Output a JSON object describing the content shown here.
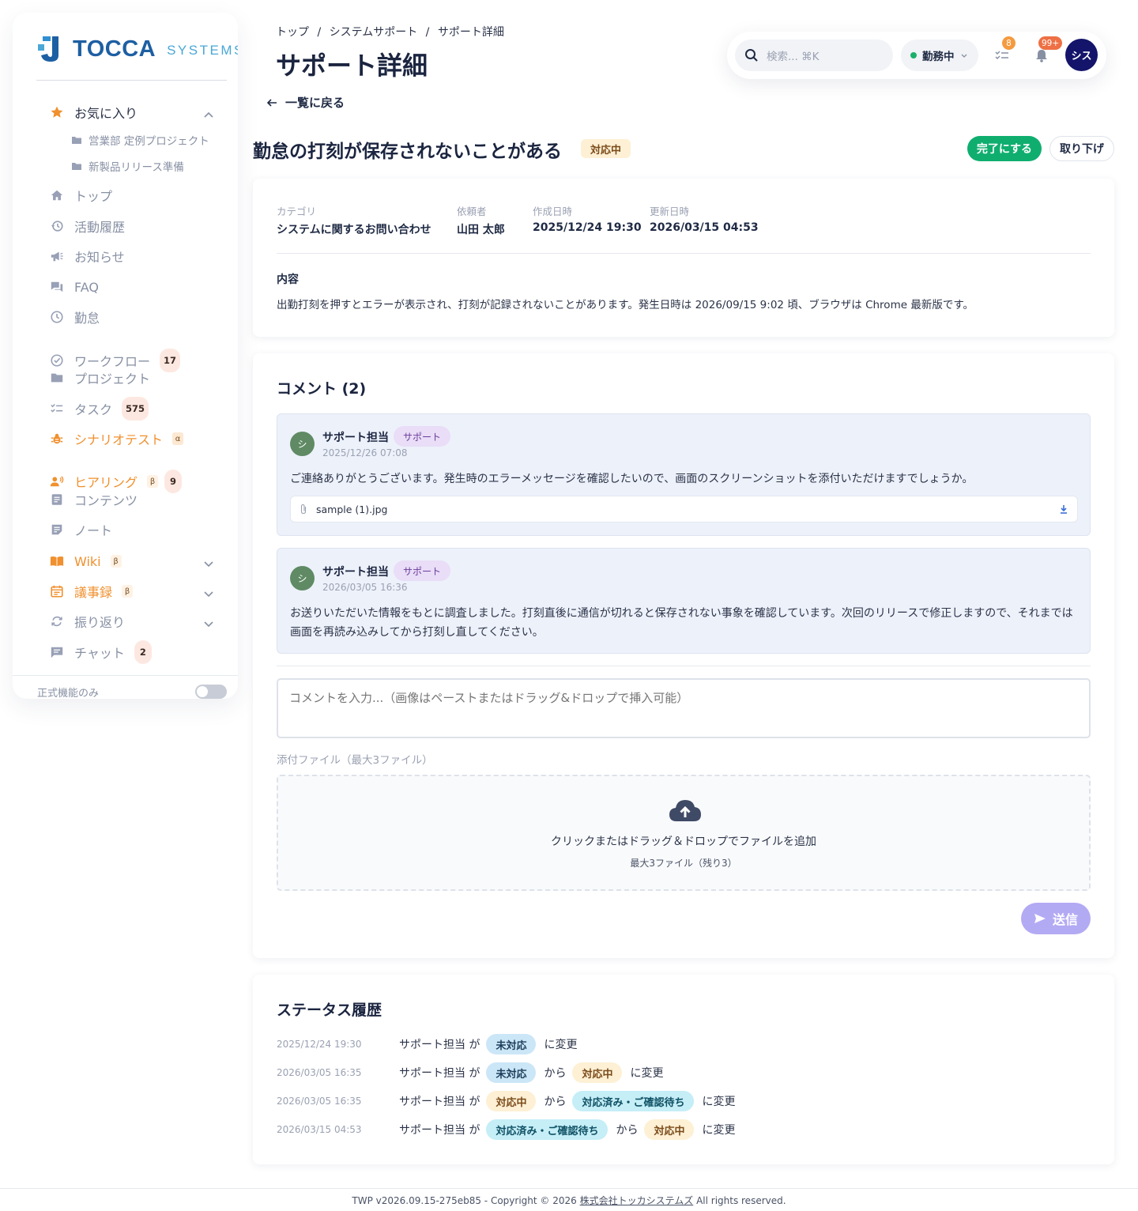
{
  "brand": {
    "name_main": "TOCCA",
    "name_sub": "SYSTEMS"
  },
  "colors": {
    "accent": "#1d5fa3",
    "orange": "#f0902e",
    "green": "#0fae6f",
    "purple": "#b3aaf4",
    "navy": "#13146a"
  },
  "sidebar": {
    "favorites_label": "お気に入り",
    "favorites": [
      "営業部 定例プロジェクト",
      "新製品リリース準備"
    ],
    "items": [
      {
        "label": "トップ",
        "icon": "home-icon"
      },
      {
        "label": "活動履歴",
        "icon": "history-icon"
      },
      {
        "label": "お知らせ",
        "icon": "megaphone-icon"
      },
      {
        "label": "FAQ",
        "icon": "faq-icon"
      },
      {
        "label": "勤怠",
        "icon": "clock-icon"
      },
      {
        "label": "ワークフロー",
        "icon": "check-circle-icon",
        "count": "17"
      },
      {
        "label": "プロジェクト",
        "icon": "folder-icon"
      },
      {
        "label": "タスク",
        "icon": "tasks-icon",
        "count": "575"
      },
      {
        "label": "シナリオテスト",
        "icon": "bug-icon",
        "tag": "α"
      },
      {
        "label": "ヒアリング",
        "icon": "people-icon",
        "tag": "β",
        "count": "9"
      },
      {
        "label": "コンテンツ",
        "icon": "document-icon"
      },
      {
        "label": "ノート",
        "icon": "note-icon"
      },
      {
        "label": "Wiki",
        "icon": "book-icon",
        "tag": "β"
      },
      {
        "label": "議事録",
        "icon": "calendar-icon",
        "tag": "β"
      },
      {
        "label": "振り返り",
        "icon": "refresh-icon"
      },
      {
        "label": "チャット",
        "icon": "chat-icon",
        "count": "2"
      }
    ],
    "footer_label": "正式機能のみ"
  },
  "header": {
    "breadcrumb": [
      "トップ",
      "/",
      "システムサポート",
      "/",
      "サポート詳細"
    ],
    "title": "サポート詳細",
    "search_placeholder": "検索... ⌘K",
    "work_status": "勤務中",
    "task_count": "8",
    "notif_count": "99+",
    "avatar_text": "シス"
  },
  "ticket": {
    "back_label": "一覧に戻る",
    "title": "勤怠の打刻が保存されないことがある",
    "status": "対応中",
    "complete_button": "完了にする",
    "withdraw_button": "取り下げ",
    "meta": [
      {
        "label": "カテゴリ",
        "value": "システムに関するお問い合わせ"
      },
      {
        "label": "依頼者",
        "value": "山田 太郎"
      },
      {
        "label": "作成日時",
        "value": "2025/12/24 19:30"
      },
      {
        "label": "更新日時",
        "value": "2026/03/15 04:53"
      }
    ],
    "content_label": "内容",
    "content": "出勤打刻を押すとエラーが表示され、打刻が記録されないことがあります。発生日時は 2026/09/15 9:02 頃、ブラウザは Chrome 最新版です。"
  },
  "comments": {
    "title": "コメント (2)",
    "items": [
      {
        "avatar": "シ",
        "author": "サポート担当",
        "role": "サポート",
        "time": "2025/12/26 07:08",
        "text": "ご連絡ありがとうございます。発生時のエラーメッセージを確認したいので、画面のスクリーンショットを添付いただけますでしょうか。",
        "attachment": "sample (1).jpg"
      },
      {
        "avatar": "シ",
        "author": "サポート担当",
        "role": "サポート",
        "time": "2026/03/05 16:36",
        "text": "お送りいただいた情報をもとに調査しました。打刻直後に通信が切れると保存されない事象を確認しています。次回のリリースで修正しますので、それまでは画面を再読み込みしてから打刻し直してください。"
      }
    ],
    "input_placeholder": "コメントを入力...（画像はペーストまたはドラッグ&ドロップで挿入可能）",
    "attach_label": "添付ファイル（最大3ファイル）",
    "dropzone_text": "クリックまたはドラッグ＆ドロップでファイルを追加",
    "dropzone_sub": "最大3ファイル（残り3）",
    "send_label": "送信"
  },
  "history": {
    "title": "ステータス履歴",
    "actor_text": "サポート担当 が",
    "from_text": "から",
    "changed_text": "に変更",
    "rows": [
      {
        "time": "2025/12/24 19:30",
        "to": "未対応"
      },
      {
        "time": "2026/03/05 16:35",
        "from": "未対応",
        "to": "対応中"
      },
      {
        "time": "2026/03/05 16:35",
        "from": "対応中",
        "to": "対応済み・ご確認待ち"
      },
      {
        "time": "2026/03/15 04:53",
        "from": "対応済み・ご確認待ち",
        "to": "対応中"
      }
    ]
  },
  "footer": {
    "version": "TWP v2026.09.15-275eb85 - Copyright © 2026",
    "company": "株式会社トッカシステムズ",
    "rights": "All rights reserved."
  }
}
